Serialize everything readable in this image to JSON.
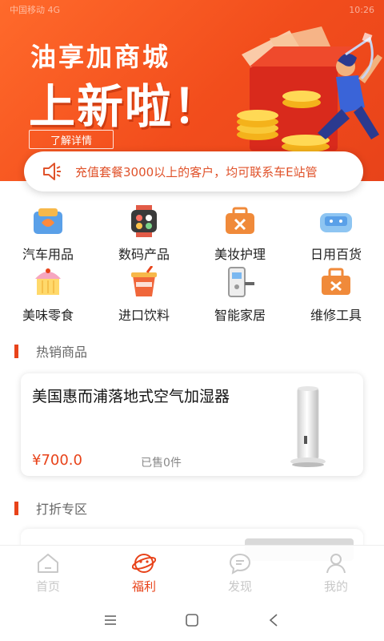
{
  "status_bar": {
    "left": "中国移动 4G",
    "right": "10:26"
  },
  "banner": {
    "title_line1": "油享加商城",
    "title_line2": "上新啦！",
    "learn_more": "了解详情"
  },
  "notice": {
    "text": "充值套餐3000以上的客户，均可联系车E站管"
  },
  "categories": [
    {
      "label": "汽车用品",
      "icon": "car-supplies-icon"
    },
    {
      "label": "数码产品",
      "icon": "digital-products-icon"
    },
    {
      "label": "美妆护理",
      "icon": "beauty-care-icon"
    },
    {
      "label": "日用百货",
      "icon": "daily-goods-icon"
    },
    {
      "label": "美味零食",
      "icon": "snacks-icon"
    },
    {
      "label": "进口饮料",
      "icon": "drinks-icon"
    },
    {
      "label": "智能家居",
      "icon": "smart-home-icon"
    },
    {
      "label": "维修工具",
      "icon": "repair-tools-icon"
    }
  ],
  "sections": {
    "hot": "热销商品",
    "discount": "打折专区"
  },
  "products": [
    {
      "name": "美国惠而浦落地式空气加湿器",
      "price": "¥700.0",
      "sold": "已售0件"
    }
  ],
  "tabs": [
    {
      "label": "首页",
      "icon": "home-icon",
      "active": false
    },
    {
      "label": "福利",
      "icon": "welfare-icon",
      "active": true
    },
    {
      "label": "发现",
      "icon": "discover-icon",
      "active": false
    },
    {
      "label": "我的",
      "icon": "profile-icon",
      "active": false
    }
  ],
  "colors": {
    "accent": "#e8431a",
    "banner": "#f24d1c",
    "inactive": "#c8c8c8"
  }
}
